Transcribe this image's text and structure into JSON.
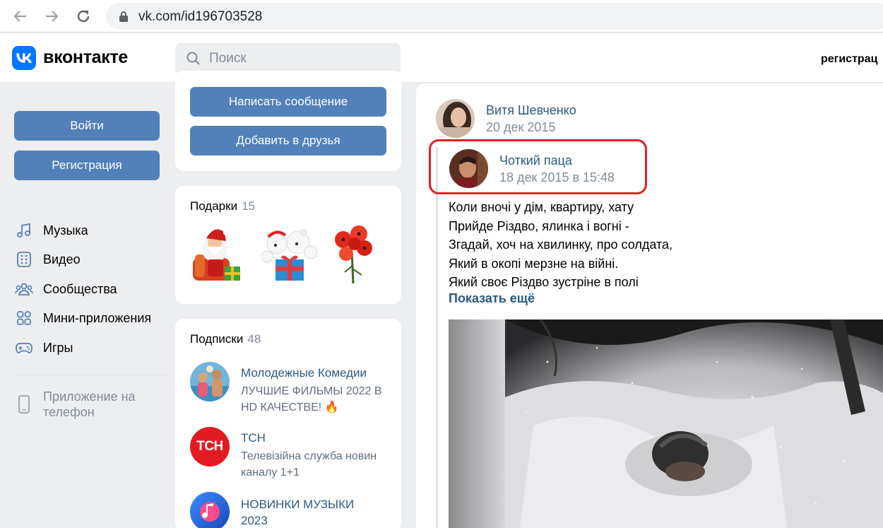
{
  "browser": {
    "url": "vk.com/id196703528"
  },
  "header": {
    "logo_letter": "VK",
    "brand": "вконтакте",
    "search_placeholder": "Поиск",
    "register_link": "регистрац"
  },
  "sidebar": {
    "login_button": "Войти",
    "register_button": "Регистрация",
    "items": [
      {
        "label": "Музыка",
        "icon": "music-icon"
      },
      {
        "label": "Видео",
        "icon": "video-icon"
      },
      {
        "label": "Сообщества",
        "icon": "communities-icon"
      },
      {
        "label": "Мини-приложения",
        "icon": "mini-apps-icon"
      },
      {
        "label": "Игры",
        "icon": "gamepad-icon"
      }
    ],
    "app_phone": "Приложение на телефон"
  },
  "profile_actions": {
    "message_button": "Написать сообщение",
    "add_friend_button": "Добавить в друзья"
  },
  "gifts": {
    "title": "Подарки",
    "count": "15"
  },
  "subscriptions": {
    "title": "Подписки",
    "count": "48",
    "items": [
      {
        "name": "Молодежные Комедии",
        "desc": "ЛУЧШИЕ ФИЛЬМЫ 2022 В HD КАЧЕСТВЕ! 🔥"
      },
      {
        "name": "ТСН",
        "desc": "Телевізійна служба новин каналу 1+1",
        "avatar_text": "ТСН"
      },
      {
        "name": "НОВИНКИ МУЗЫКИ 2023",
        "desc": ""
      }
    ]
  },
  "post": {
    "author": "Витя Шевченко",
    "date": "20 дек 2015",
    "original_author": "Чоткий паца",
    "original_date": "18 дек 2015 в 15:48",
    "text_lines": [
      "Коли вночі у дім, квартиру, хату",
      "Прийде Різдво, ялинка і вогні -",
      "Згадай, хоч на хвилинку, про солдата,",
      "Який в окопі мерзне на війні.",
      "Який своє Різдво зустріне в полі"
    ],
    "show_more": "Показать ещё"
  },
  "colors": {
    "vk_blue": "#0077ff",
    "button_blue": "#5181b8",
    "link_blue": "#2a5885",
    "highlight_red": "#e41e26"
  }
}
